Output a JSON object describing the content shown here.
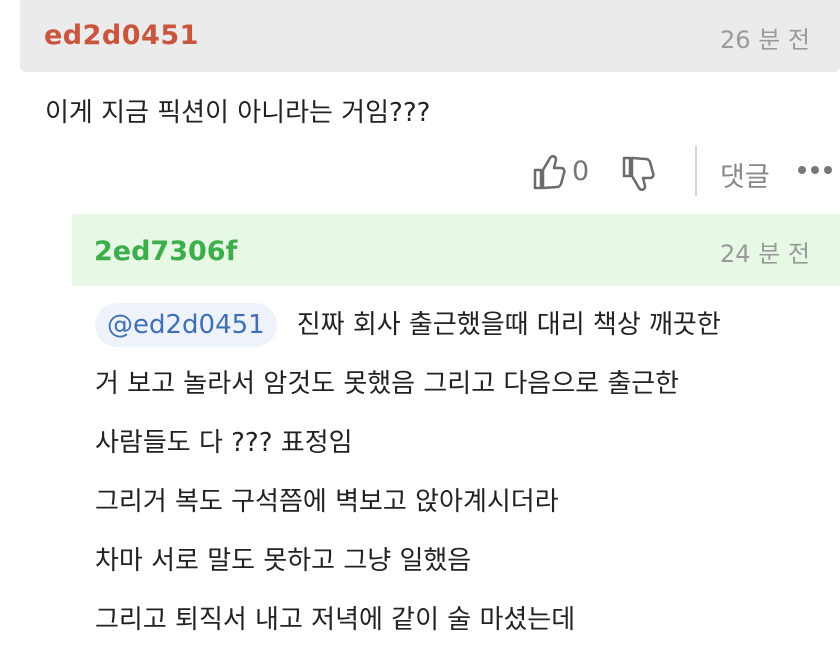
{
  "comment": {
    "author": "ed2d0451",
    "time": "26 분 전",
    "text": "이게 지금 픽션이 아니라는 거임???",
    "likes": "0",
    "reply_label": "댓글"
  },
  "reply": {
    "author": "2ed7306f",
    "time": "24 분 전",
    "mention": "@ed2d0451",
    "lines": [
      "진짜 회사 출근했을때 대리 책상 깨끗한",
      "거 보고 놀라서 암것도 못했음 그리고 다음으로 출근한",
      "사람들도 다 ??? 표정임",
      "그리거 복도 구석쯤에 벽보고 앉아계시더라",
      "차마 서로 말도 못하고 그냥 일했음",
      "그리고 퇴직서 내고 저녁에 같이 술 마셨는데"
    ]
  },
  "icons": {
    "like": "thumbs-up-icon",
    "dislike": "thumbs-down-icon",
    "more": "more-dots-icon"
  },
  "colors": {
    "author_red": "#c9553e",
    "author_green": "#3cae4c",
    "mention_blue": "#3f6fb5"
  }
}
